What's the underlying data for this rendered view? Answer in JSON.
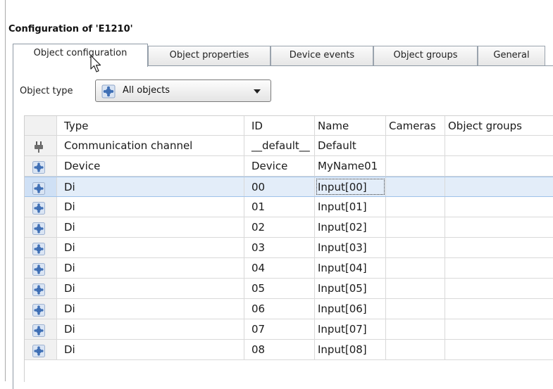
{
  "title": "Configuration of 'E1210'",
  "tabs": [
    {
      "label": "Object configuration",
      "active": true
    },
    {
      "label": "Object properties",
      "active": false
    },
    {
      "label": "Device events",
      "active": false
    },
    {
      "label": "Object groups",
      "active": false
    },
    {
      "label": "General",
      "active": false
    }
  ],
  "object_type": {
    "label": "Object type",
    "selected": "All objects"
  },
  "table": {
    "columns": [
      "Type",
      "ID",
      "Name",
      "Cameras",
      "Object groups"
    ],
    "rows": [
      {
        "icon": "plug-icon",
        "type": "Communication channel",
        "id": "__default__",
        "name": "Default",
        "cameras": "",
        "groups": ""
      },
      {
        "icon": "puzzle-icon",
        "type": "Device",
        "id": "Device",
        "name": "MyName01",
        "cameras": "",
        "groups": ""
      },
      {
        "icon": "puzzle-icon",
        "type": "Di",
        "id": "00",
        "name": "Input[00]",
        "cameras": "",
        "groups": "",
        "selected": true
      },
      {
        "icon": "puzzle-icon",
        "type": "Di",
        "id": "01",
        "name": "Input[01]",
        "cameras": "",
        "groups": ""
      },
      {
        "icon": "puzzle-icon",
        "type": "Di",
        "id": "02",
        "name": "Input[02]",
        "cameras": "",
        "groups": ""
      },
      {
        "icon": "puzzle-icon",
        "type": "Di",
        "id": "03",
        "name": "Input[03]",
        "cameras": "",
        "groups": ""
      },
      {
        "icon": "puzzle-icon",
        "type": "Di",
        "id": "04",
        "name": "Input[04]",
        "cameras": "",
        "groups": ""
      },
      {
        "icon": "puzzle-icon",
        "type": "Di",
        "id": "05",
        "name": "Input[05]",
        "cameras": "",
        "groups": ""
      },
      {
        "icon": "puzzle-icon",
        "type": "Di",
        "id": "06",
        "name": "Input[06]",
        "cameras": "",
        "groups": ""
      },
      {
        "icon": "puzzle-icon",
        "type": "Di",
        "id": "07",
        "name": "Input[07]",
        "cameras": "",
        "groups": ""
      },
      {
        "icon": "puzzle-icon",
        "type": "Di",
        "id": "08",
        "name": "Input[08]",
        "cameras": "",
        "groups": ""
      }
    ]
  },
  "colors": {
    "selection": "#e3edf9",
    "puzzle_blue": "#3f6fb5",
    "plug_gray": "#6d6d6d"
  }
}
